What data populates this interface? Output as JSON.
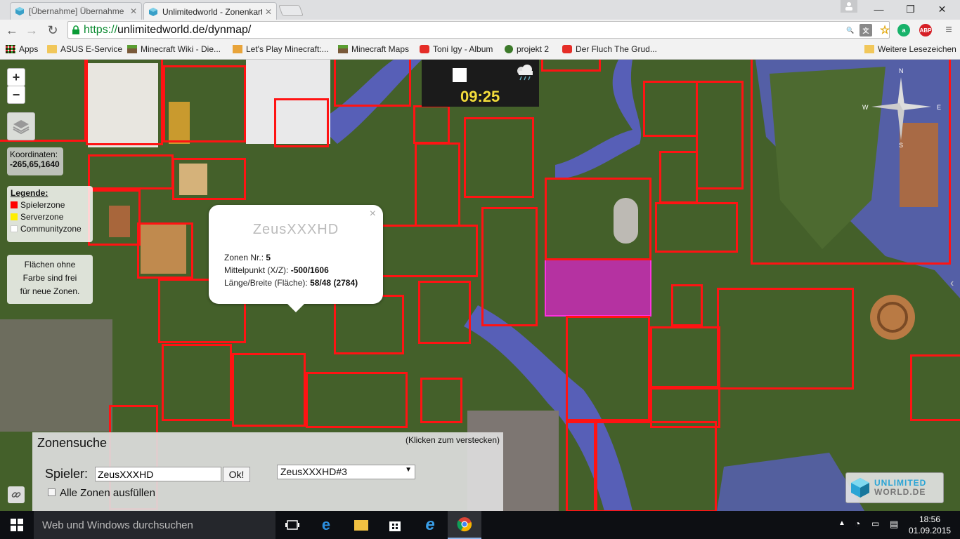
{
  "browser": {
    "tabs": [
      {
        "title": "[Übernahme] Übernahme",
        "active": false
      },
      {
        "title": "Unlimitedworld - Zonenkarte",
        "active": true
      }
    ],
    "url": "https://unlimitedworld.de/dynmap/",
    "url_scheme": "https://",
    "url_rest": "unlimitedworld.de/dynmap/",
    "extensions": {
      "abp": "ABP"
    },
    "bookmarks": [
      {
        "label": "Apps",
        "icon": "apps-grid-icon"
      },
      {
        "label": "ASUS E-Service",
        "icon": "folder-icon"
      },
      {
        "label": "Minecraft Wiki - Die...",
        "icon": "grass-block-icon"
      },
      {
        "label": "Let's Play Minecraft:...",
        "icon": "letsplay-icon"
      },
      {
        "label": "Minecraft Maps",
        "icon": "grass-block-icon"
      },
      {
        "label": "Toni Igy - Album",
        "icon": "youtube-icon"
      },
      {
        "label": "projekt 2",
        "icon": "green-dot-icon"
      },
      {
        "label": "Der Fluch The Grud...",
        "icon": "youtube-icon"
      }
    ],
    "other_bookmarks": "Weitere Lesezeichen"
  },
  "map": {
    "clock": "09:25",
    "coordinates_label": "Koordinaten:",
    "coordinates_value": "-265,65,1640",
    "legend_title": "Legende:",
    "legend": [
      {
        "label": "Spielerzone",
        "color": "#ff0000"
      },
      {
        "label": "Serverzone",
        "color": "#ffee00"
      },
      {
        "label": "Communityzone",
        "color": "#ffffff"
      }
    ],
    "note_lines": [
      "Flächen ohne",
      "Farbe sind frei",
      "für neue Zonen."
    ],
    "zoom_in": "+",
    "zoom_out": "−",
    "compass": {
      "n": "N",
      "e": "E",
      "s": "S",
      "w": "W"
    },
    "popup": {
      "owner": "ZeusXXXHD",
      "close": "×",
      "zone_nr_label": "Zonen Nr.:",
      "zone_nr_value": "5",
      "center_label": "Mittelpunkt (X/Z):",
      "center_value": "-500/1606",
      "size_label": "Länge/Breite (Fläche):",
      "size_value": "58/48 (2784)"
    }
  },
  "zone_search": {
    "title": "Zonensuche",
    "hide_hint": "(Klicken zum verstecken)",
    "player_label": "Spieler:",
    "player_value": "ZeusXXXHD",
    "ok_label": "Ok!",
    "zone_select_value": "ZeusXXXHD#3",
    "fill_all_label": "Alle Zonen ausfüllen",
    "fill_all_checked": false
  },
  "logo": {
    "line1": "UNLIMITED",
    "line2": "WORLD.DE"
  },
  "taskbar": {
    "search_placeholder": "Web und Windows durchsuchen",
    "time": "18:56",
    "date": "01.09.2015"
  },
  "colors": {
    "zone_border": "#ff1313",
    "highlight_zone": "#e020d0",
    "clock_text": "#f3dc3b"
  }
}
